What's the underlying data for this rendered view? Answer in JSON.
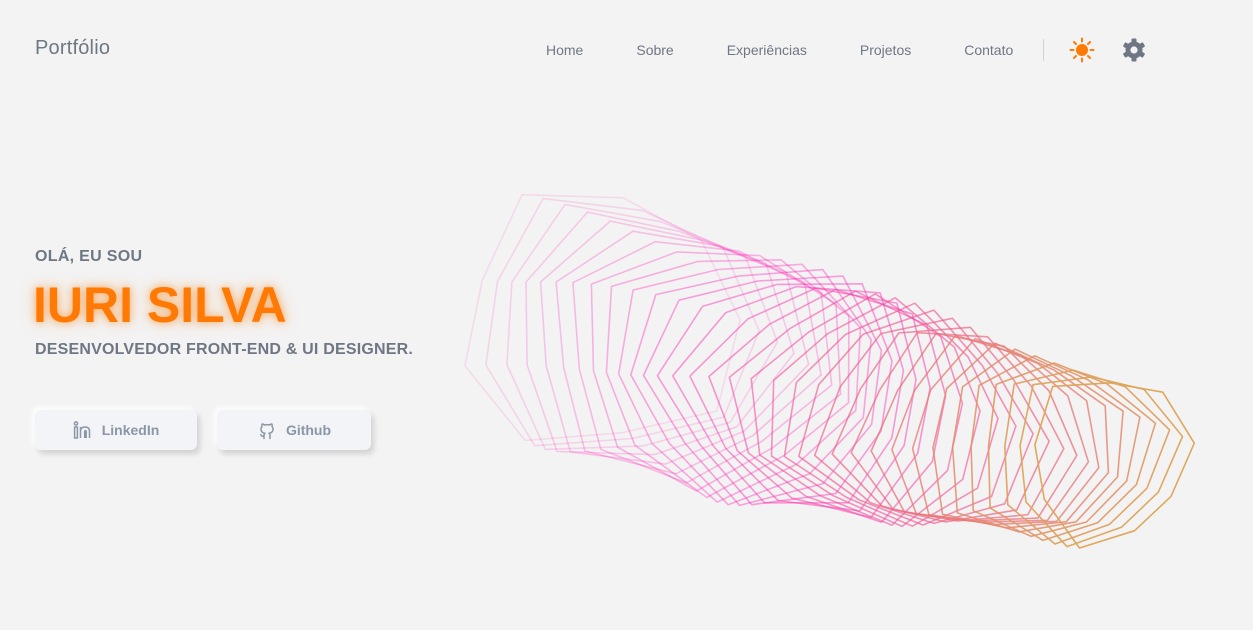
{
  "header": {
    "logo": "Portfólio",
    "nav": [
      "Home",
      "Sobre",
      "Experiências",
      "Projetos",
      "Contato"
    ],
    "theme_icon": "sun-icon",
    "settings_icon": "gear-icon"
  },
  "hero": {
    "greeting": "OLÁ, EU SOU",
    "name": "IURI SILVA",
    "role": "DESENVOLVEDOR FRONT-END & UI DESIGNER.",
    "buttons": {
      "linkedin": "LinkedIn",
      "github": "Github"
    }
  },
  "colors": {
    "accent": "#ff7a05",
    "text_muted": "#6f7784",
    "art_pink": "#ff1fb4",
    "art_lime": "#c6ff1a"
  }
}
